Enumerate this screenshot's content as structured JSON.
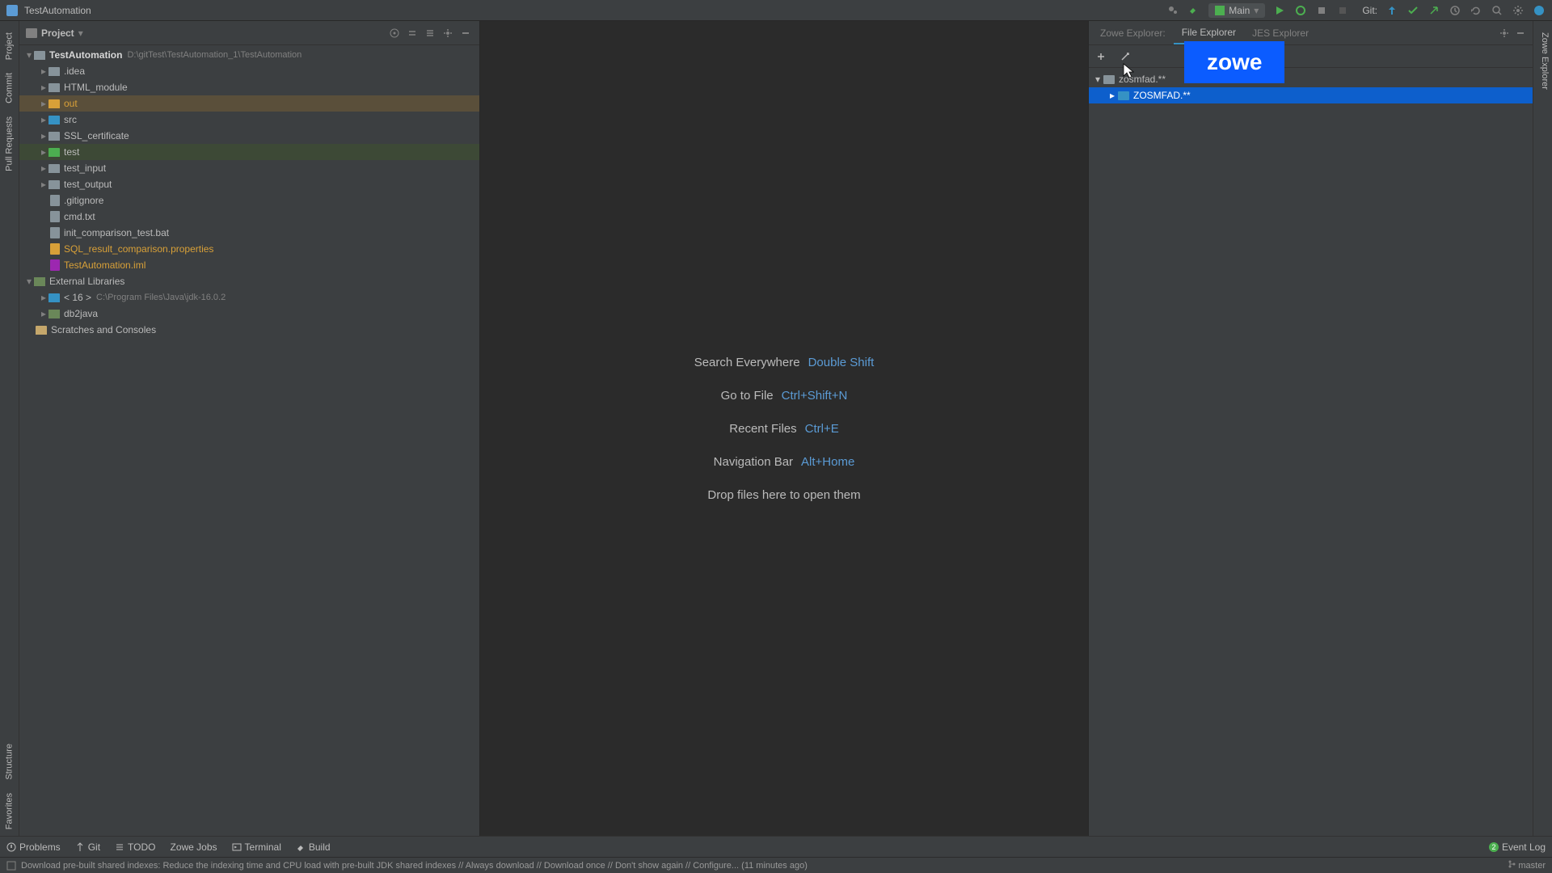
{
  "titlebar": {
    "title": "TestAutomation",
    "run_config": "Main",
    "git_label": "Git:"
  },
  "left_tabs": {
    "project": "Project",
    "commit": "Commit",
    "pull_requests": "Pull Requests",
    "structure": "Structure",
    "favorites": "Favorites"
  },
  "right_tabs": {
    "zowe_explorer": "Zowe Explorer"
  },
  "project_panel": {
    "title": "Project",
    "root": {
      "name": "TestAutomation",
      "path": "D:\\gitTest\\TestAutomation_1\\TestAutomation"
    },
    "items": [
      {
        "name": ".idea",
        "type": "folder",
        "indent": 1,
        "expandable": true
      },
      {
        "name": "HTML_module",
        "type": "folder",
        "indent": 1,
        "expandable": true
      },
      {
        "name": "out",
        "type": "folder-orange",
        "indent": 1,
        "expandable": true,
        "highlight": "orange"
      },
      {
        "name": "src",
        "type": "folder-blue",
        "indent": 1,
        "expandable": true
      },
      {
        "name": "SSL_certificate",
        "type": "folder",
        "indent": 1,
        "expandable": true
      },
      {
        "name": "test",
        "type": "folder-green",
        "indent": 1,
        "expandable": true,
        "highlight": "green"
      },
      {
        "name": "test_input",
        "type": "folder",
        "indent": 1,
        "expandable": true
      },
      {
        "name": "test_output",
        "type": "folder",
        "indent": 1,
        "expandable": true
      },
      {
        "name": ".gitignore",
        "type": "file",
        "indent": 1
      },
      {
        "name": "cmd.txt",
        "type": "file",
        "indent": 1
      },
      {
        "name": "init_comparison_test.bat",
        "type": "file",
        "indent": 1
      },
      {
        "name": "SQL_result_comparison.properties",
        "type": "file-orange",
        "indent": 1,
        "label_color": "orange"
      },
      {
        "name": "TestAutomation.iml",
        "type": "file-purple",
        "indent": 1,
        "label_color": "orange"
      }
    ],
    "external_libraries": "External Libraries",
    "jdk": {
      "prefix": "< 16 >",
      "path": "C:\\Program Files\\Java\\jdk-16.0.2"
    },
    "db2java": "db2java",
    "scratches": "Scratches and Consoles"
  },
  "editor_hints": {
    "search_label": "Search Everywhere",
    "search_key": "Double Shift",
    "goto_label": "Go to File",
    "goto_key": "Ctrl+Shift+N",
    "recent_label": "Recent Files",
    "recent_key": "Ctrl+E",
    "nav_label": "Navigation Bar",
    "nav_key": "Alt+Home",
    "drop_label": "Drop files here to open them"
  },
  "zowe_panel": {
    "tabs": {
      "zowe_explorer": "Zowe Explorer:",
      "file_explorer": "File Explorer",
      "jes_explorer": "JES Explorer"
    },
    "badge": "zowe",
    "tree": {
      "profile": "zosmfad.**",
      "dataset": "ZOSMFAD.**"
    }
  },
  "bottom_bar": {
    "problems": "Problems",
    "git": "Git",
    "todo": "TODO",
    "zowe_jobs": "Zowe Jobs",
    "terminal": "Terminal",
    "build": "Build",
    "event_log": "Event Log",
    "event_count": "2"
  },
  "status_bar": {
    "message": "Download pre-built shared indexes: Reduce the indexing time and CPU load with pre-built JDK shared indexes // Always download // Download once // Don't show again // Configure... (11 minutes ago)",
    "branch": "master"
  }
}
